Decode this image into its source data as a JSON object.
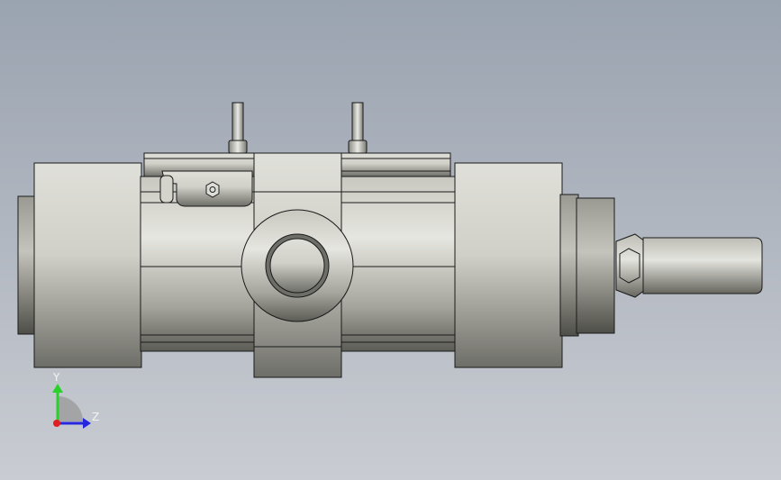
{
  "triad": {
    "y_label": "Y",
    "z_label": "Z",
    "y_color": "#2bd12b",
    "z_color": "#2727e0",
    "x_color": "#e02020"
  },
  "colors": {
    "background_top": "#9aa3b0",
    "background_bottom": "#c9ccd2",
    "part_fill": "#c4c4bc",
    "edge": "#1a1a1a"
  }
}
